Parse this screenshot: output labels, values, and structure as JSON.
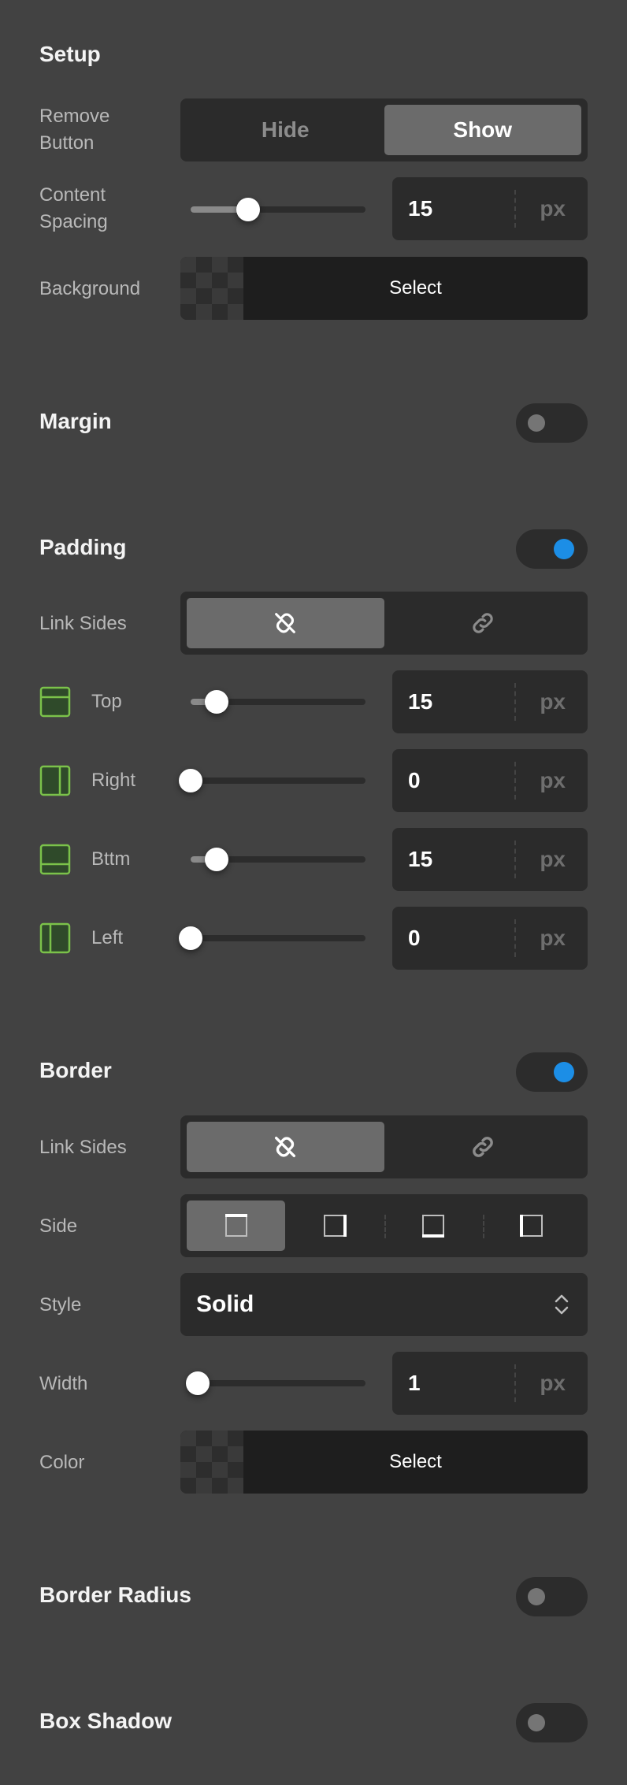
{
  "colors": {
    "background": "#424242",
    "control_bg": "#2b2b2b",
    "active_segment": "#6b6b6b",
    "toggle_on": "#1c8ee6",
    "side_icon_green": "#7bc24a"
  },
  "setup": {
    "title": "Setup",
    "remove_button": {
      "label_line1": "Remove",
      "label_line2": "Button",
      "options": [
        "Hide",
        "Show"
      ],
      "selected": "Show"
    },
    "content_spacing": {
      "label_line1": "Content",
      "label_line2": "Spacing",
      "value": "15",
      "unit": "px",
      "slider_fraction": 0.33
    },
    "background": {
      "label": "Background",
      "button": "Select"
    }
  },
  "margin": {
    "title": "Margin",
    "enabled": false
  },
  "padding": {
    "title": "Padding",
    "enabled": true,
    "link_sides": {
      "label": "Link Sides",
      "options": [
        "unlink-icon",
        "link-icon"
      ],
      "selected": "unlink-icon"
    },
    "sides": [
      {
        "label": "Top",
        "value": "15",
        "unit": "px",
        "slider_fraction": 0.15,
        "icon": "side-top-icon"
      },
      {
        "label": "Right",
        "value": "0",
        "unit": "px",
        "slider_fraction": 0.0,
        "icon": "side-right-icon"
      },
      {
        "label": "Bttm",
        "value": "15",
        "unit": "px",
        "slider_fraction": 0.15,
        "icon": "side-bottom-icon"
      },
      {
        "label": "Left",
        "value": "0",
        "unit": "px",
        "slider_fraction": 0.0,
        "icon": "side-left-icon"
      }
    ]
  },
  "border": {
    "title": "Border",
    "enabled": true,
    "link_sides": {
      "label": "Link Sides",
      "options": [
        "unlink-icon",
        "link-icon"
      ],
      "selected": "unlink-icon"
    },
    "side": {
      "label": "Side",
      "options": [
        "border-top-icon",
        "border-right-icon",
        "border-bottom-icon",
        "border-left-icon"
      ],
      "selected": "border-top-icon"
    },
    "style": {
      "label": "Style",
      "value": "Solid"
    },
    "width": {
      "label": "Width",
      "value": "1",
      "unit": "px",
      "slider_fraction": 0.04
    },
    "color": {
      "label": "Color",
      "button": "Select"
    }
  },
  "border_radius": {
    "title": "Border Radius",
    "enabled": false
  },
  "box_shadow": {
    "title": "Box Shadow",
    "enabled": false
  }
}
